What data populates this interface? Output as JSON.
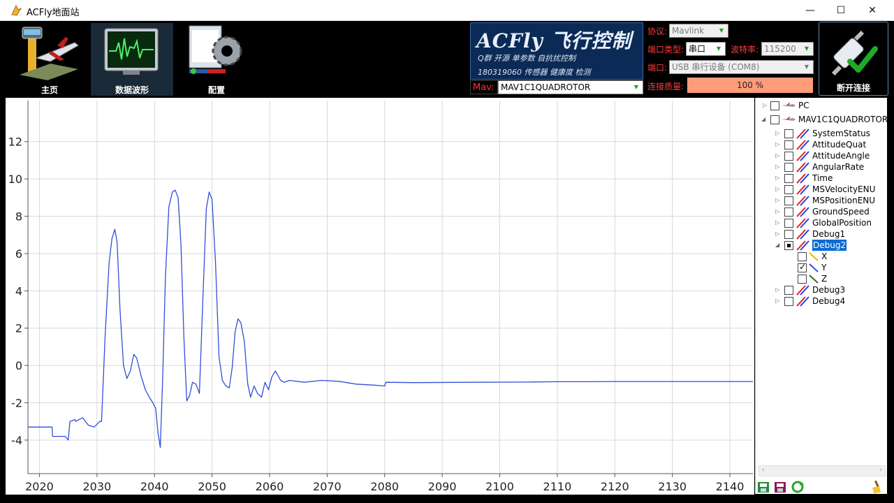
{
  "window": {
    "title": "ACFly地面站",
    "minimize": "—",
    "maximize": "☐",
    "close": "✕"
  },
  "nav": [
    {
      "label": "主页",
      "icon": "airport-icon"
    },
    {
      "label": "数据波形",
      "icon": "waveform-monitor-icon"
    },
    {
      "label": "配置",
      "icon": "settings-gear-icon"
    }
  ],
  "logo": {
    "title": "ACFly 飞行控制",
    "line1": "Q群  开源 单参数 自抗扰控制",
    "line2": "180319060 传感器 健康度 检测"
  },
  "connection": {
    "mav_label": "Mav:",
    "mav_value": "MAV1C1QUADROTOR",
    "protocol_label": "协议:",
    "protocol_value": "Mavlink",
    "porttype_label": "端口类型:",
    "porttype_value": "串口",
    "baud_label": "波特率:",
    "baud_value": "115200",
    "port_label": "端口:",
    "port_value": "USB 串行设备 (COM8)",
    "quality_label": "连接质量:",
    "quality_value": "100  %",
    "disconnect_label": "断开连接"
  },
  "tree": {
    "pc": "PC",
    "vehicle": "MAV1C1QUADROTOR",
    "items": [
      "SystemStatus",
      "AttitudeQuat",
      "AttitudeAngle",
      "AngularRate",
      "Time",
      "MSVelocityENU",
      "MSPositionENU",
      "GroundSpeed",
      "GlobalPosition",
      "Debug1",
      "Debug2",
      "Debug3",
      "Debug4"
    ],
    "debug2_children": [
      {
        "label": "X",
        "checked": false,
        "color": "#d4c000"
      },
      {
        "label": "Y",
        "checked": true,
        "color": "#3050e0"
      },
      {
        "label": "Z",
        "checked": false,
        "color": "#3a6a1a"
      }
    ]
  },
  "chart_data": {
    "type": "line",
    "title": "",
    "xlabel": "",
    "ylabel": "",
    "xlim": [
      2018,
      2144
    ],
    "ylim": [
      -5.8,
      14.2
    ],
    "xticks": [
      2020,
      2030,
      2040,
      2050,
      2060,
      2070,
      2080,
      2090,
      2100,
      2110,
      2120,
      2130,
      2140
    ],
    "yticks": [
      -4,
      -2,
      0,
      2,
      4,
      6,
      8,
      10,
      12
    ],
    "grid": true,
    "series": [
      {
        "color": "#2f4fd8",
        "x": [
          2018,
          2022.2,
          2022.3,
          2024.5,
          2025,
          2025.3,
          2026.2,
          2026.3,
          2027.5,
          2028.5,
          2029.5,
          2030.5,
          2030.8,
          2031.4,
          2032.1,
          2032.6,
          2033.1,
          2033.5,
          2034.0,
          2034.6,
          2035.2,
          2035.8,
          2036.4,
          2036.9,
          2037.7,
          2038.4,
          2039.1,
          2039.7,
          2040.2,
          2040.6,
          2041.0,
          2041.4,
          2041.9,
          2042.5,
          2043.1,
          2043.6,
          2044.1,
          2044.6,
          2045.1,
          2045.6,
          2046.1,
          2046.6,
          2047.2,
          2047.8,
          2048.4,
          2049.0,
          2049.5,
          2050.0,
          2050.6,
          2051.2,
          2051.8,
          2052.4,
          2053.0,
          2053.5,
          2054.0,
          2054.5,
          2055.0,
          2055.6,
          2056.2,
          2056.7,
          2057.3,
          2057.9,
          2058.6,
          2059.2,
          2059.8,
          2060.4,
          2061.0,
          2061.4,
          2061.9,
          2062.5,
          2063.5,
          2066,
          2069,
          2072,
          2075,
          2078,
          2080,
          2080.2,
          2085,
          2095,
          2105,
          2110,
          2115,
          2120,
          2125,
          2135,
          2144
        ],
        "y": [
          -3.3,
          -3.3,
          -3.8,
          -3.8,
          -4.0,
          -3.0,
          -2.9,
          -3.0,
          -2.8,
          -3.2,
          -3.3,
          -3.0,
          -3.0,
          1.5,
          5.5,
          6.8,
          7.3,
          6.6,
          3.0,
          0.0,
          -0.7,
          -0.3,
          0.6,
          0.4,
          -0.6,
          -1.3,
          -1.7,
          -2.0,
          -2.3,
          -3.6,
          -4.4,
          -0.8,
          4.8,
          8.5,
          9.3,
          9.4,
          9.0,
          6.5,
          1.5,
          -1.9,
          -1.6,
          -0.9,
          -1.0,
          -1.5,
          3.5,
          8.4,
          9.3,
          8.9,
          5.5,
          0.5,
          -0.8,
          -1.1,
          -1.2,
          -0.1,
          1.8,
          2.5,
          2.3,
          1.3,
          -1.0,
          -1.7,
          -1.1,
          -1.5,
          -1.7,
          -0.9,
          -1.3,
          -0.6,
          -0.3,
          -0.5,
          -0.8,
          -0.9,
          -0.8,
          -0.9,
          -0.8,
          -0.85,
          -1.0,
          -1.05,
          -1.1,
          -0.9,
          -0.92,
          -0.9,
          -0.89,
          -0.87,
          -0.87,
          -0.86,
          -0.86,
          -0.86,
          -0.86
        ]
      }
    ]
  }
}
